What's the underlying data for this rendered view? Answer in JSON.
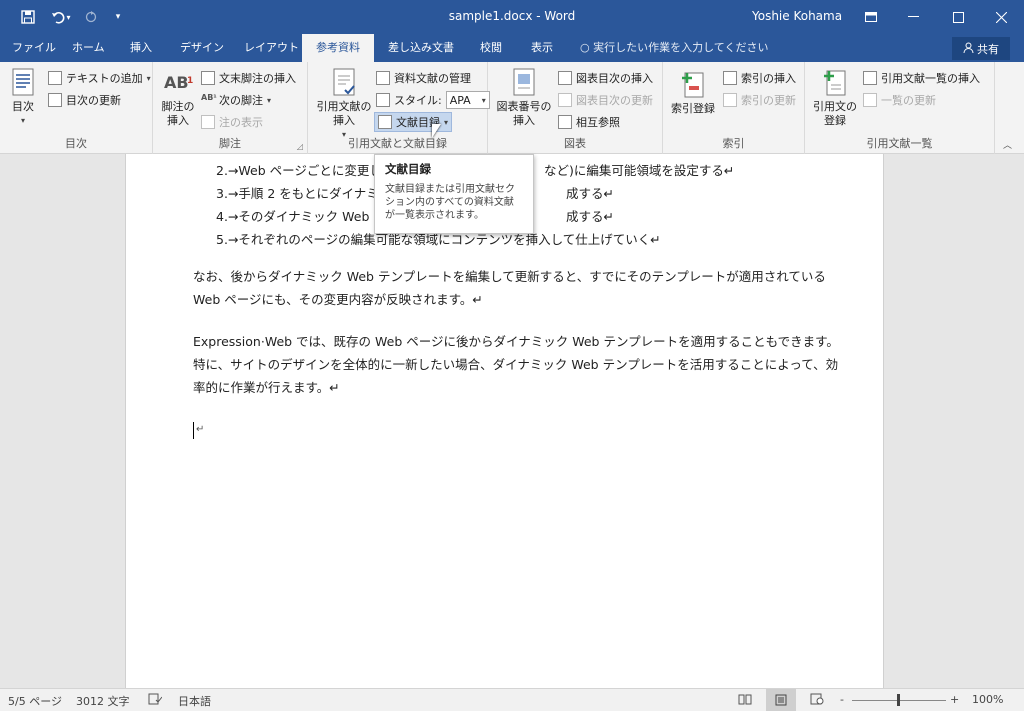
{
  "titlebar": {
    "title": "sample1.docx - Word",
    "user": "Yoshie Kohama",
    "undo_caret": "▾",
    "qat_customize": "▾"
  },
  "tabs": [
    {
      "label": "ファイル"
    },
    {
      "label": "ホーム"
    },
    {
      "label": "挿入"
    },
    {
      "label": "デザイン"
    },
    {
      "label": "レイアウト"
    },
    {
      "label": "参考資料"
    },
    {
      "label": "差し込み文書"
    },
    {
      "label": "校閲"
    },
    {
      "label": "表示"
    }
  ],
  "tellme": "実行したい作業を入力してください",
  "share": "共有",
  "ribbon": {
    "toc": {
      "big": "目次",
      "add_text": "テキストの追加",
      "update_toc": "目次の更新",
      "label": "目次"
    },
    "footnotes": {
      "big1": "脚注の",
      "big2": "挿入",
      "insert_endnote": "文末脚注の挿入",
      "next_footnote": "次の脚注",
      "show_notes": "注の表示",
      "label": "脚注",
      "ab": "AB",
      "ab_sup": "1"
    },
    "citations": {
      "big1": "引用文献の",
      "big2": "挿入",
      "manage_sources": "資料文献の管理",
      "style_label": "スタイル:",
      "style_value": "APA",
      "bibliography": "文献目録",
      "label": "引用文献と文献目録"
    },
    "captions": {
      "big1": "図表番号の",
      "big2": "挿入",
      "insert_tof": "図表目次の挿入",
      "update_table": "図表目次の更新",
      "cross_ref": "相互参照",
      "label": "図表"
    },
    "index": {
      "big": "索引登録",
      "insert_index": "索引の挿入",
      "update_index": "索引の更新",
      "label": "索引"
    },
    "toa": {
      "big1": "引用文の",
      "big2": "登録",
      "insert_toa": "引用文献一覧の挿入",
      "update_toa": "一覧の更新",
      "label": "引用文献一覧"
    }
  },
  "tooltip": {
    "title": "文献目録",
    "body": "文献目録または引用文献セクション内のすべての資料文献が一覧表示されます。"
  },
  "document": {
    "list": [
      "2.→Web ページごとに変更し",
      "3.→手順 2 をもとにダイナミッ",
      "4.→そのダイナミック Web テ",
      "5.→それぞれのページの編集可能な領域にコンテンツを挿入して仕上げていく↵"
    ],
    "list_tail": [
      "など)に編集可能領域を設定する↵",
      "成する↵",
      "成する↵"
    ],
    "para1": [
      "なお、後からダイナミック Web テンプレートを編集して更新すると、すでにそのテンプレートが適用されている",
      "Web ページにも、その変更内容が反映されます。↵"
    ],
    "para2": [
      "Expression·Web では、既存の Web ページに後からダイナミック Web テンプレートを適用することもできます。",
      "特に、サイトのデザインを全体的に一新したい場合、ダイナミック Web テンプレートを活用することによって、効",
      "率的に作業が行えます。↵"
    ],
    "para3_mark": "↵"
  },
  "status": {
    "page": "5/5 ページ",
    "words": "3012 文字",
    "language": "日本語",
    "zoom": "100%",
    "zoom_minus": "-",
    "zoom_plus": "+",
    "zoom_fraction": 1.0
  },
  "colors": {
    "accent": "#2b579a"
  }
}
